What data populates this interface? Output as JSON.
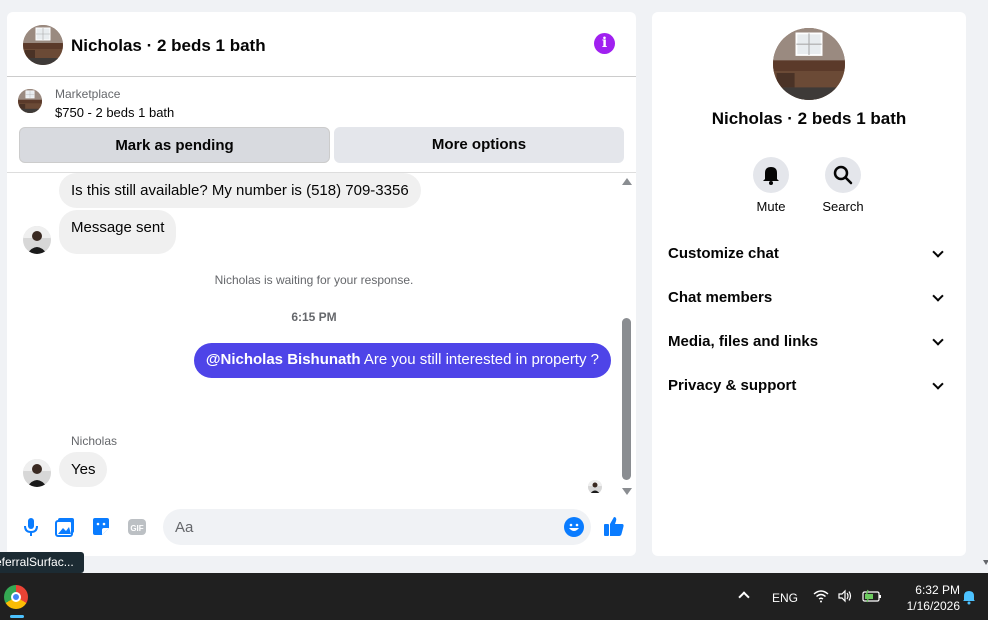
{
  "chat": {
    "title": "Nicholas · 2 beds 1 bath",
    "listing": {
      "category": "Marketplace",
      "price_summary": "$750 - 2 beds 1 bath"
    },
    "buttons": {
      "mark_pending": "Mark as pending",
      "more_options": "More options"
    },
    "messages": {
      "first": "Is this still available? My number is (518) 709-3356",
      "second": "Message sent",
      "system_note": "Nicholas is waiting for your response.",
      "timestamp": "6:15 PM",
      "outgoing_mention": "@Nicholas Bishunath",
      "outgoing_text": " Are you still interested in property ?",
      "sender_name": "Nicholas",
      "reply": "Yes"
    },
    "composer": {
      "placeholder": "Aa"
    }
  },
  "info_panel": {
    "name": "Nicholas · 2 beds 1 bath",
    "actions": {
      "mute": "Mute",
      "search": "Search"
    },
    "sections": [
      "Customize chat",
      "Chat members",
      "Media, files and links",
      "Privacy & support"
    ]
  },
  "tooltip": "eferralSurfac...",
  "taskbar": {
    "language": "ENG",
    "time": "6:32 PM",
    "date": "1/16/2026"
  },
  "colors": {
    "accent": "#4e44e8",
    "info": "#a020f0",
    "messenger_blue": "#0a7cff"
  }
}
